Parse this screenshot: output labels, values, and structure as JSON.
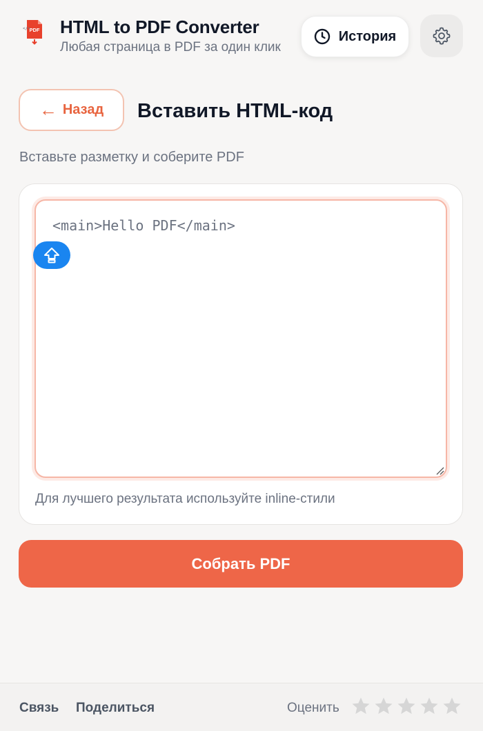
{
  "header": {
    "title": "HTML to PDF Converter",
    "subtitle": "Любая страница в PDF за один клик",
    "logo_icon": "html-pdf-file-icon",
    "history_label": "История",
    "history_icon": "clock-icon",
    "settings_icon": "gear-icon"
  },
  "nav": {
    "back_label": "Назад",
    "back_icon": "arrow-left-icon",
    "page_title": "Вставить HTML-код"
  },
  "main": {
    "description": "Вставьте разметку и соберите PDF",
    "editor_value": "<main>Hello PDF</main>",
    "editor_hint": "Для лучшего результата используйте inline-стили",
    "float_icon": "arrow-up-icon",
    "build_label": "Собрать PDF"
  },
  "footer": {
    "contact_label": "Связь",
    "share_label": "Поделиться",
    "rate_label": "Оценить",
    "stars_total": 5,
    "stars_filled": 0
  },
  "colors": {
    "accent": "#ee6648",
    "accent_text": "#e8643f",
    "float_button": "#1a85f0",
    "background": "#f7f6f5"
  }
}
